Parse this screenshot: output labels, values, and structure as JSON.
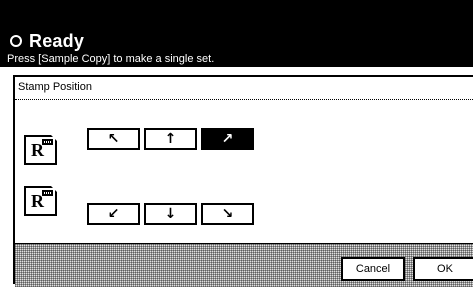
{
  "header": {
    "title": "Ready",
    "hint": "Press [Sample Copy] to make a single set."
  },
  "panel": {
    "title": "Stamp Position",
    "paper_letter": "R",
    "top_row": [
      {
        "arrow": "↖",
        "name": "top-left",
        "selected": false
      },
      {
        "arrow": "↑",
        "name": "top-center",
        "selected": false
      },
      {
        "arrow": "↗",
        "name": "top-right",
        "selected": true
      }
    ],
    "bottom_row": [
      {
        "arrow": "↙",
        "name": "bottom-left",
        "selected": false
      },
      {
        "arrow": "↓",
        "name": "bottom-center",
        "selected": false
      },
      {
        "arrow": "↘",
        "name": "bottom-right",
        "selected": false
      }
    ]
  },
  "actions": {
    "cancel_label": "Cancel",
    "ok_label": "OK"
  }
}
